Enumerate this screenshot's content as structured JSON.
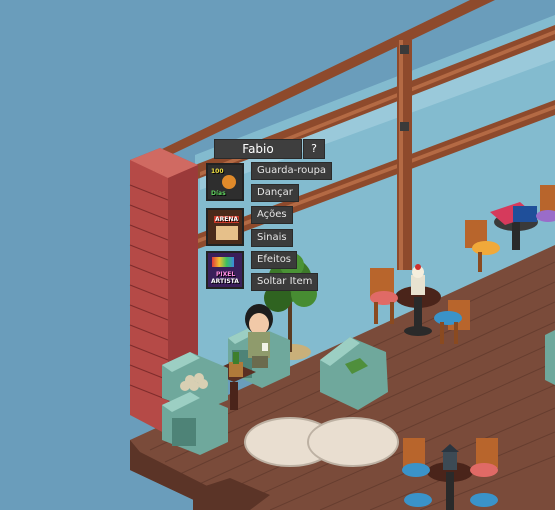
{
  "avatar_menu": {
    "username": "Fabio",
    "help_label": "?",
    "items": [
      {
        "label": "Guarda-roupa"
      },
      {
        "label": "Dançar"
      },
      {
        "label": "Ações"
      },
      {
        "label": "Sinais"
      },
      {
        "label": "Efeitos"
      },
      {
        "label": "Soltar Item"
      }
    ]
  },
  "badges": [
    {
      "name": "badge-100-days",
      "text_top": "100",
      "text_bottom": "Días"
    },
    {
      "name": "badge-arena",
      "text_top": "ARENA",
      "text_bottom": ""
    },
    {
      "name": "badge-pixel-artista",
      "text_top": "PIXEL",
      "text_bottom": "ARTISTA"
    }
  ],
  "colors": {
    "sky": "#6a9dbb",
    "floor": "#7a4b3a",
    "brick": "#b54a47",
    "railing": "#8e4a2c",
    "menu_bg": "#3b3b3b",
    "sofa": "#6fa89c"
  }
}
